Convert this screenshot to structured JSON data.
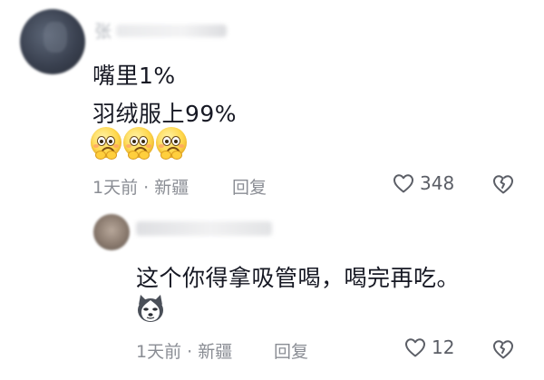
{
  "comment": {
    "username": "张",
    "lines": [
      "嘴里1%",
      "羽绒服上99%"
    ],
    "emoji_icon": "sweating-worried-face-emoji",
    "emoji_count": 3,
    "time_location": "1天前 · 新疆",
    "reply_label": "回复",
    "like_count": "348"
  },
  "reply": {
    "username": "",
    "text": "这个你得拿吸管喝，喝完再吃。",
    "sticker_icon": "husky-dog-emoji",
    "time_location": "1天前 · 新疆",
    "reply_label": "回复",
    "like_count": "12"
  },
  "colors": {
    "text_primary": "#161823",
    "text_secondary": "#8a8d94",
    "background": "#ffffff"
  }
}
